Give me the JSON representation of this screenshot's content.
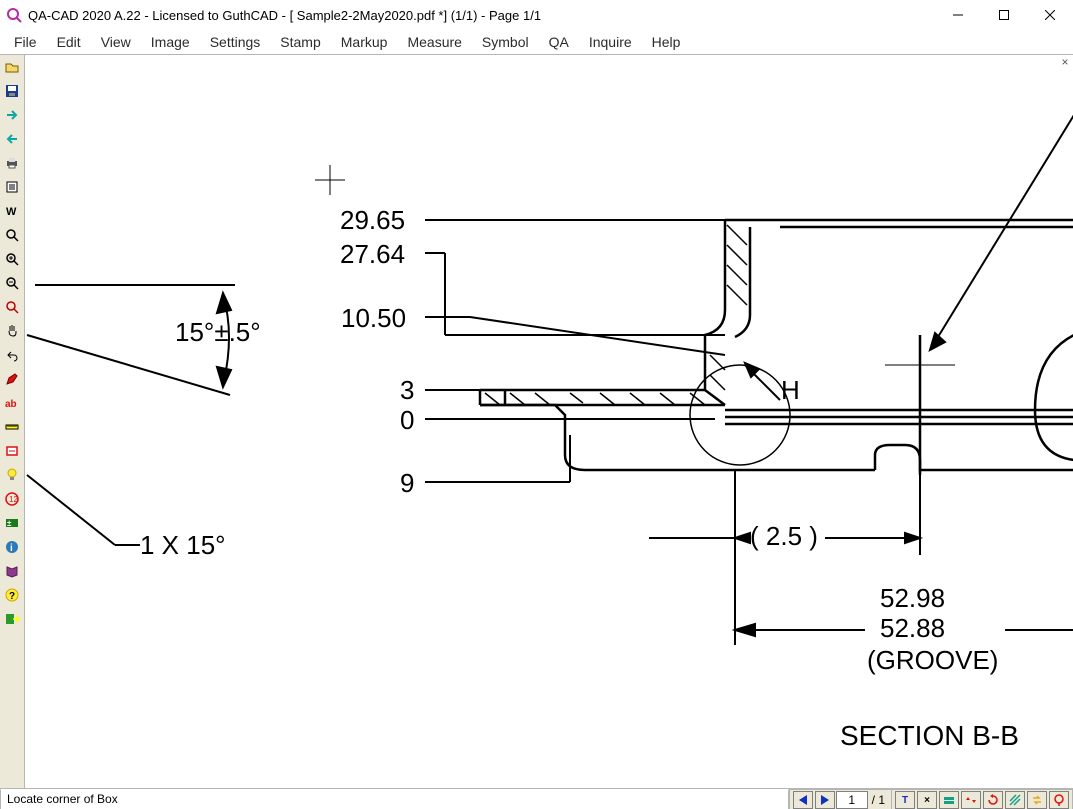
{
  "window": {
    "title": "QA-CAD 2020 A.22 - Licensed to GuthCAD  -  [ Sample2-2May2020.pdf *] (1/1)  -  Page 1/1"
  },
  "menus": [
    "File",
    "Edit",
    "View",
    "Image",
    "Settings",
    "Stamp",
    "Markup",
    "Measure",
    "Symbol",
    "QA",
    "Inquire",
    "Help"
  ],
  "toolbar_icons": [
    "open-icon",
    "save-icon",
    "forward-arrow-icon",
    "back-arrow-icon",
    "print-icon",
    "read-icon",
    "font-icon",
    "zoom-icon",
    "zoom-in-icon",
    "zoom-out-icon",
    "zoom-select-icon",
    "pan-icon",
    "undo-icon",
    "pencil-icon",
    "ab-text-icon",
    "ruler-icon",
    "stamp-icon",
    "bulb-icon",
    "revision-icon",
    "logo-icon",
    "info-icon",
    "book-icon",
    "help2-icon",
    "exit-icon"
  ],
  "drawing": {
    "dim_2965": "29.65",
    "dim_2764": "27.64",
    "dim_1050": "10.50",
    "dim_3": "3",
    "dim_0": "0",
    "dim_9": "9",
    "ref_h": "H",
    "ref_25": "( 2.5 )",
    "dim_5298": "52.98",
    "dim_5288": "52.88",
    "groove": "(GROOVE)",
    "section": "SECTION B-B",
    "angle_15": "15°±.5°",
    "chamfer": "1 X 15°"
  },
  "status": {
    "text": "Locate corner of Box"
  },
  "pager": {
    "current": "1",
    "total": "/ 1"
  },
  "right_tools": [
    "T",
    "×",
    "layers-icon",
    "flip-icon",
    "rotate-icon",
    "hatch-icon",
    "swap-icon",
    "balloon-icon"
  ]
}
